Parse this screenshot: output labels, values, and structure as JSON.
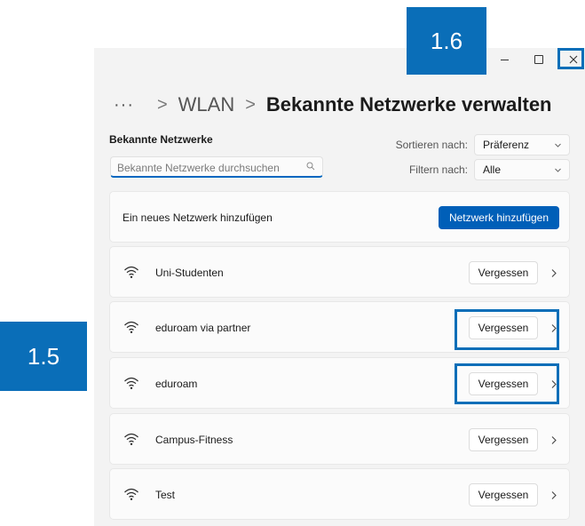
{
  "window": {
    "controls": {
      "minimize_icon": "minimize-icon",
      "maximize_icon": "maximize-icon",
      "close_icon": "close-icon"
    }
  },
  "breadcrumb": {
    "overflow": "···",
    "separator": ">",
    "parent": "WLAN",
    "current": "Bekannte Netzwerke verwalten"
  },
  "known_networks": {
    "title": "Bekannte Netzwerke",
    "search": {
      "value": "",
      "placeholder": "Bekannte Netzwerke durchsuchen",
      "icon": "search-icon"
    },
    "sort": {
      "label": "Sortieren nach:",
      "value": "Präferenz"
    },
    "filter": {
      "label": "Filtern nach:",
      "value": "Alle"
    },
    "add": {
      "text": "Ein neues Netzwerk hinzufügen",
      "button": "Netzwerk hinzufügen"
    },
    "networks": [
      {
        "name": "Uni-Studenten",
        "forget": "Vergessen"
      },
      {
        "name": "eduroam via partner",
        "forget": "Vergessen"
      },
      {
        "name": "eduroam",
        "forget": "Vergessen"
      },
      {
        "name": "Campus-Fitness",
        "forget": "Vergessen"
      },
      {
        "name": "Test",
        "forget": "Vergessen"
      }
    ]
  },
  "annotations": {
    "badge_close": "1.6",
    "badge_forget": "1.5"
  },
  "colors": {
    "accent": "#005fb8",
    "annotation": "#0a6eb8",
    "window_bg": "#f3f3f3"
  }
}
